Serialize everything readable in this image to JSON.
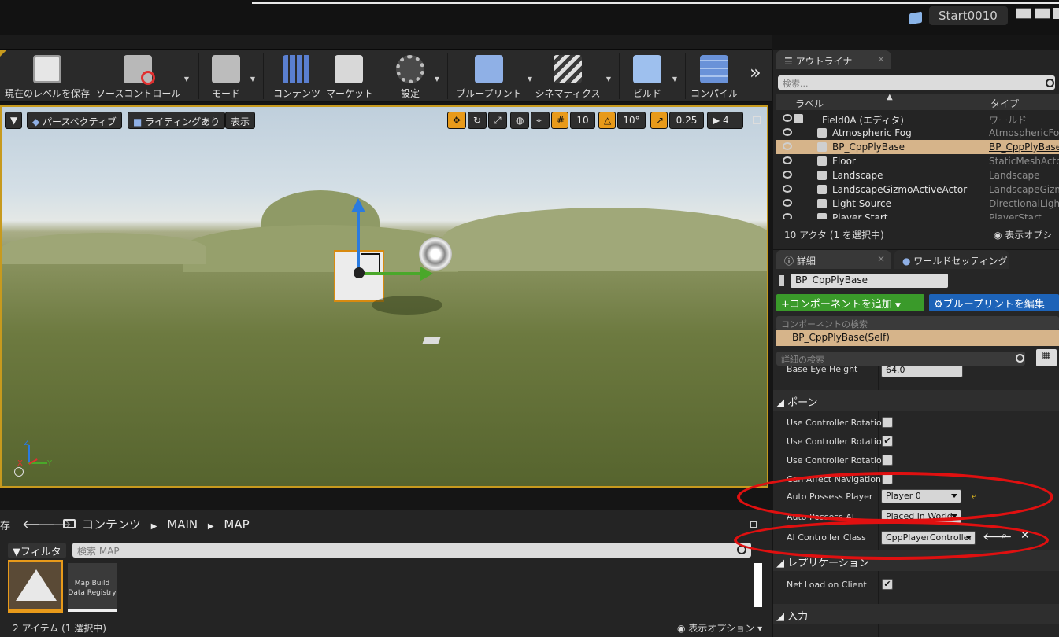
{
  "window": {
    "project": "Start0010"
  },
  "toolbar": {
    "items": [
      {
        "label": "現在のレベルを保存"
      },
      {
        "label": "ソースコントロール"
      },
      {
        "label": "モード"
      },
      {
        "label": "コンテンツ"
      },
      {
        "label": "マーケット"
      },
      {
        "label": "設定"
      },
      {
        "label": "ブループリント"
      },
      {
        "label": "シネマティクス"
      },
      {
        "label": "ビルド"
      },
      {
        "label": "コンパイル"
      }
    ],
    "more": "»"
  },
  "viewport": {
    "perspective": "パースペクティブ",
    "lighting": "ライティングあり",
    "show": "表示",
    "grid_snap": "10",
    "rot_snap": "10°",
    "scale_snap": "0.25",
    "cam_speed": "4",
    "axis_x": "X",
    "axis_y": "Y",
    "axis_z": "Z"
  },
  "content_browser": {
    "breadcrumb": [
      "コンテンツ",
      "MAIN",
      "MAP"
    ],
    "save_label": "存",
    "filter": "フィルタ",
    "search_placeholder": "検索 MAP",
    "assets": [
      {
        "label": ""
      },
      {
        "label": "Map Build Data Registry"
      }
    ],
    "status": "2 アイテム (1 選択中)",
    "view_options": "表示オプション"
  },
  "outliner": {
    "tab": "アウトライナ",
    "search_placeholder": "検索...",
    "col_label": "ラベル",
    "col_type": "タイプ",
    "rows": [
      {
        "name": "Field0A (エディタ)",
        "type": "ワールド"
      },
      {
        "name": "Atmospheric Fog",
        "type": "AtmosphericFog"
      },
      {
        "name": "BP_CppPlyBase",
        "type": "BP_CppPlyBase"
      },
      {
        "name": "Floor",
        "type": "StaticMeshActor"
      },
      {
        "name": "Landscape",
        "type": "Landscape"
      },
      {
        "name": "LandscapeGizmoActiveActor",
        "type": "LandscapeGizmo"
      },
      {
        "name": "Light Source",
        "type": "DirectionalLight"
      },
      {
        "name": "Player Start",
        "type": "PlayerStart"
      }
    ],
    "count": "10 アクタ (1 を選択中)",
    "view_options": "表示オプシ"
  },
  "details": {
    "tab": "詳細",
    "tab2": "ワールドセッティング",
    "actor_name": "BP_CppPlyBase",
    "add_component": "+コンポーネントを追加",
    "edit_blueprint": "ブループリントを編集",
    "component_search": "コンポーネントの検索",
    "self_component": "BP_CppPlyBase(Self)",
    "detail_search": "詳細の検索",
    "cut_prop": "Base Eye Height",
    "cut_value": "64.0",
    "cat_pawn": "ポーン",
    "props": [
      {
        "label": "Use Controller Rotation",
        "checked": false
      },
      {
        "label": "Use Controller Rotation",
        "checked": true
      },
      {
        "label": "Use Controller Rotation",
        "checked": false
      },
      {
        "label": "Can Affect Navigation G",
        "checked": false
      }
    ],
    "auto_possess_player": {
      "label": "Auto Possess Player",
      "value": "Player 0"
    },
    "auto_possess_ai": {
      "label": "Auto Possess AI",
      "value": "Placed in World"
    },
    "ai_controller": {
      "label": "AI Controller Class",
      "value": "CppPlayerController"
    },
    "cat_replication": "レプリケーション",
    "net_load": {
      "label": "Net Load on Client",
      "checked": true
    },
    "cat_input": "入力"
  },
  "colors": {
    "accent": "#e89a1a",
    "selection": "#d6b48a",
    "add_green": "#3a9a2a",
    "edit_blue": "#1d63b8",
    "annotation_red": "#e01010"
  }
}
